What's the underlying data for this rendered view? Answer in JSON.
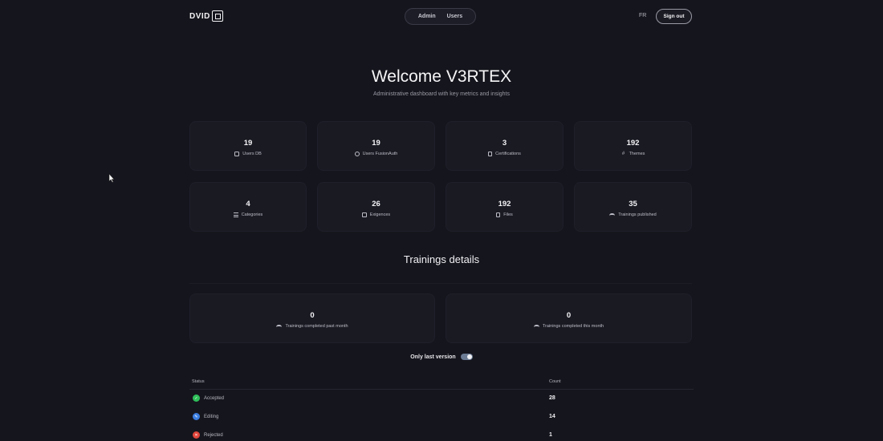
{
  "header": {
    "logo_text": "DVID",
    "nav": [
      {
        "label": "Admin"
      },
      {
        "label": "Users"
      }
    ],
    "lang": "FR",
    "signout_label": "Sign out"
  },
  "hero": {
    "title": "Welcome V3RTEX",
    "subtitle": "Administrative dashboard with key metrics and insights"
  },
  "stats": [
    {
      "value": "19",
      "label": "Users DB",
      "icon": "database-icon"
    },
    {
      "value": "19",
      "label": "Users FusionAuth",
      "icon": "globe-icon"
    },
    {
      "value": "3",
      "label": "Certifications",
      "icon": "certificate-icon"
    },
    {
      "value": "192",
      "label": "Themes",
      "icon": "hash-icon"
    },
    {
      "value": "4",
      "label": "Categories",
      "icon": "list-icon"
    },
    {
      "value": "26",
      "label": "Exigences",
      "icon": "edit-icon"
    },
    {
      "value": "192",
      "label": "Files",
      "icon": "file-icon"
    },
    {
      "value": "35",
      "label": "Trainings published",
      "icon": "graduation-cap-icon"
    }
  ],
  "trainings": {
    "title": "Trainings details",
    "cards": [
      {
        "value": "0",
        "label": "Trainings completed past month",
        "icon": "graduation-cap-icon"
      },
      {
        "value": "0",
        "label": "Trainings completed this month",
        "icon": "graduation-cap-icon"
      }
    ],
    "toggle_label": "Only last version",
    "toggle_on": true
  },
  "table": {
    "headers": {
      "status": "Status",
      "count": "Count"
    },
    "rows": [
      {
        "status": "Accepted",
        "count": "28",
        "color": "#2fbf5a",
        "icon": "check-icon"
      },
      {
        "status": "Editing",
        "count": "14",
        "color": "#3b7de0",
        "icon": "edit-icon"
      },
      {
        "status": "Rejected",
        "count": "1",
        "color": "#e0453b",
        "icon": "x-icon"
      }
    ]
  },
  "colors": {
    "background": "#15151d",
    "card": "#1a1a23",
    "accent_toggle": "#6b7b94"
  }
}
